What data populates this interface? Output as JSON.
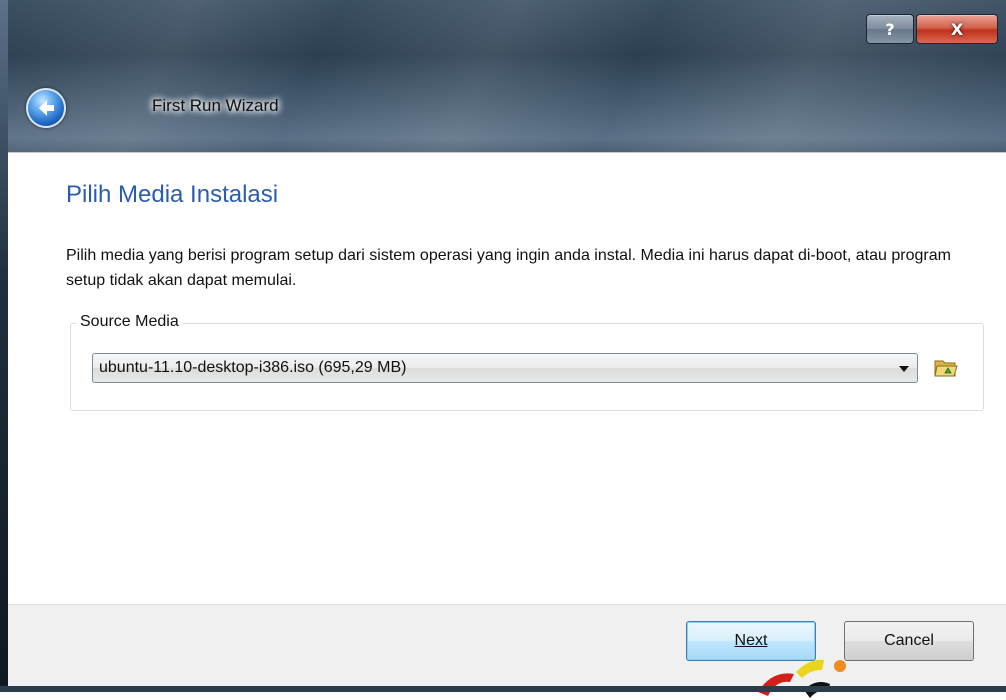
{
  "window": {
    "title": "First Run Wizard",
    "help_glyph": "?",
    "close_glyph": "X",
    "back_icon": "back-arrow-icon"
  },
  "page": {
    "heading": "Pilih Media Instalasi",
    "description": "Pilih media yang berisi program setup dari sistem operasi yang ingin anda instal. Media ini harus dapat di-boot, atau program setup tidak akan dapat memulai."
  },
  "source_media": {
    "legend": "Source Media",
    "selected": "ubuntu-11.10-desktop-i386.iso (695,29 MB)",
    "browse_icon": "folder-open-icon"
  },
  "buttons": {
    "next": "Next",
    "cancel": "Cancel"
  },
  "colors": {
    "heading": "#2a5db0",
    "close_button": "#c0301a",
    "next_button_border": "#3c7fb1"
  }
}
